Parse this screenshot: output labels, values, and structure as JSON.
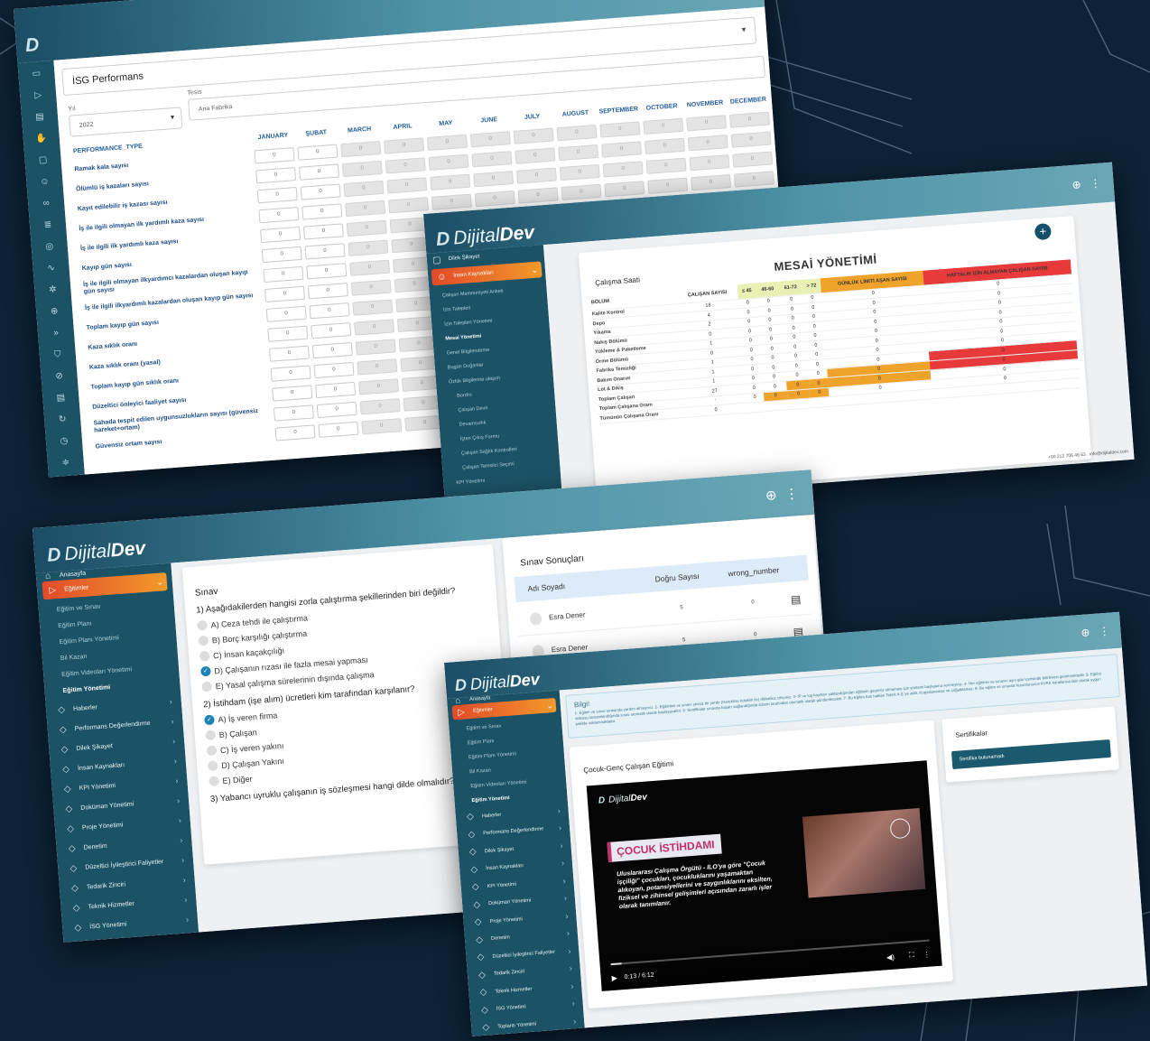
{
  "brand": {
    "name_light": "Dijital",
    "name_bold": "Dev",
    "mark": "D"
  },
  "colors": {
    "background": "#0d2236",
    "sidebar": "#1c5266",
    "accent": "#f0772a",
    "danger": "#e83a3a",
    "warning": "#f0a32a",
    "highlight": "#e8f0b4",
    "link_blue": "#1d4e86"
  },
  "topbar_icons": [
    "globe-icon",
    "more-vert-icon"
  ],
  "isg_window": {
    "page_title": "İSG Performans",
    "year_label": "Yıl",
    "year_value": "2022",
    "facility_label": "Tesis",
    "facility_value": "Ana Fabrika",
    "type_header": "PERFORMANCE_TYPE",
    "months": [
      "JANUARY",
      "ŞUBAT",
      "MARCH",
      "APRIL",
      "MAY",
      "JUNE",
      "JULY",
      "AUGUST",
      "SEPTEMBER",
      "OCTOBER",
      "NOVEMBER",
      "DECEMBER"
    ],
    "cell_value": "0",
    "rows": [
      "Ramak kala sayısı",
      "Ölümlü iş kazaları sayısı",
      "Kayıt edilebilir iş kazası sayısı",
      "İş ile ilgili olmayan ilk yardımlı kaza sayısı",
      "İş ile ilgili ilk yardımlı kaza sayısı",
      "Kayıp gün sayısı",
      "İş ile ilgili olmayan ilkyardımcı kazalardan oluşan kayıp gün sayısı",
      "İş ile ilgili ilkyardımlı kazalardan oluşan kayıp gün sayısı",
      "Toplam kayıp gün sayısı",
      "Kaza sıklık oranı",
      "Kaza sıklık oranı (yasal)",
      "Toplam kayıp gün sıklık oranı",
      "Düzeltici önleyici faaliyet sayısı",
      "Sahada tespit edilen uygunsuzlukların sayısı (güvensiz hareket+ortam)",
      "Güvensiz ortam sayısı"
    ],
    "side_icons": [
      "monitor-icon",
      "play-icon",
      "document-icon",
      "thumbs-up-icon",
      "chat-icon",
      "users-icon",
      "link-icon",
      "database-icon",
      "target-icon",
      "pulse-icon",
      "gear-icon",
      "globe-icon",
      "forward-icon",
      "shield-icon",
      "compass-icon",
      "doc-icon",
      "refresh-icon",
      "clock-icon",
      "sliders-icon"
    ]
  },
  "mesai_window": {
    "title": "MESAİ YÖNETİMİ",
    "subtitle": "Çalışma Saati",
    "add_button": "+",
    "menu_top": "Dilek Şikayet",
    "menu_active": "İnsan Kaynakları",
    "menu_sub": [
      "Çalışan Memnuniyeti Anketi",
      "İzin Talepleri",
      "İzin Talepleri Yönetimi",
      "Mesai Yönetimi",
      "Genel Bilgilendirme",
      "Bugün Doğanlar",
      "Özlük Bilgilerine ulaşım",
      "Bordro",
      "Çalışan Devri",
      "Devamsızlık",
      "İşten Çıkış Formu",
      "Çalışan Sağlık Kontrolleri",
      "Çalışan Temsilci Seçimi",
      "KPI Yönetimi"
    ],
    "columns": [
      "BÖLÜM",
      "ÇALIŞAN SAYISI",
      "≤ 45",
      "46-60",
      "61-72",
      "> 72",
      "GÜNLÜK LİMİTİ AŞAN SAYISI",
      "HAFTALIK İZİN ALMAYAN ÇALIŞAN SAYISI"
    ],
    "rows": [
      {
        "name": "Kalite Kontrol",
        "count": "18",
        "a": "0",
        "b": "0",
        "c": "0",
        "d": "0",
        "daily": "0",
        "weekly": "0"
      },
      {
        "name": "Depo",
        "count": "4",
        "a": "0",
        "b": "0",
        "c": "0",
        "d": "0",
        "daily": "0",
        "weekly": "0"
      },
      {
        "name": "Yıkama",
        "count": "2",
        "a": "0",
        "b": "0",
        "c": "0",
        "d": "0",
        "daily": "0",
        "weekly": "0"
      },
      {
        "name": "Nakış Bölümü",
        "count": "0",
        "a": "0",
        "b": "0",
        "c": "0",
        "d": "0",
        "daily": "0",
        "weekly": "0"
      },
      {
        "name": "Yükleme & Paketleme",
        "count": "1",
        "a": "0",
        "b": "0",
        "c": "0",
        "d": "0",
        "daily": "0",
        "weekly": "0"
      },
      {
        "name": "Örme Bölümü",
        "count": "0",
        "a": "0",
        "b": "0",
        "c": "0",
        "d": "0",
        "daily": "0",
        "weekly": "0"
      },
      {
        "name": "Fabrika Temizliği",
        "count": "1",
        "a": "0",
        "b": "0",
        "c": "0",
        "d": "0",
        "daily": "0",
        "weekly": "0"
      },
      {
        "name": "Bakım Onarım",
        "count": "1",
        "a": "0",
        "b": "0",
        "c": "0",
        "d": "0",
        "daily": "0",
        "weekly": "0"
      },
      {
        "name": "Lot & Dikiş",
        "count": "1",
        "a": "0",
        "b": "0",
        "c": "0",
        "d": "0",
        "daily": "0",
        "weekly": "0"
      },
      {
        "name": "Toplam Çalışan",
        "count": "27",
        "a": "0",
        "b": "0",
        "c": "0",
        "d": "0",
        "daily": "0",
        "weekly": "0"
      },
      {
        "name": "Toplam Çalışana Oranı",
        "count": "-",
        "a": "0",
        "b": "0",
        "c": "0",
        "d": "0",
        "daily": "0",
        "weekly": "0"
      },
      {
        "name": "Tümünün Çalışana Oranı",
        "count": "0",
        "a": "",
        "b": "",
        "c": "",
        "d": "",
        "daily": "",
        "weekly": ""
      }
    ],
    "footer": "+90 212 706 46 63 . info@dijitaldev.com"
  },
  "sinav_window": {
    "menu_top": "Anasayfa",
    "menu_active": "Eğitimler",
    "menu_sub": [
      "Eğitim ve Sınav",
      "Eğitim Planı",
      "Eğitim Planı Yönetimi",
      "Bil Kazan",
      "Eğitim Videoları Yönetimi",
      "Eğitim Yönetimi"
    ],
    "menu_main": [
      {
        "label": "Haberler",
        "icon": "news-icon"
      },
      {
        "label": "Performans Değerlendirme",
        "icon": "thumbs-up-icon"
      },
      {
        "label": "Dilek Şikayet",
        "icon": "chat-icon"
      },
      {
        "label": "İnsan Kaynakları",
        "icon": "users-icon"
      },
      {
        "label": "KPI Yönetimi",
        "icon": "link-icon"
      },
      {
        "label": "Doküman Yönetimi",
        "icon": "database-icon"
      },
      {
        "label": "Proje Yönetimi",
        "icon": "target-icon"
      },
      {
        "label": "Denetim",
        "icon": "pulse-icon"
      },
      {
        "label": "Düzeltici İyileştirici Faliyetler",
        "icon": "gear-icon"
      },
      {
        "label": "Tedarik Zinciri",
        "icon": "globe-icon"
      },
      {
        "label": "Teknik Hizmetler",
        "icon": "forward-icon"
      },
      {
        "label": "İSG Yönetimi",
        "icon": "shield-icon"
      },
      {
        "label": "Toplantı Yönetimi",
        "icon": "compass-icon"
      }
    ],
    "exam_title": "Sınav",
    "questions": [
      {
        "text": "1) Aşağıdakilerden hangisi zorla çalıştırma şekillerinden biri değildir?",
        "options": [
          {
            "text": "A) Ceza tehdi ile çalıştırma",
            "selected": false
          },
          {
            "text": "B) Borç karşılığı çalıştırma",
            "selected": false
          },
          {
            "text": "C) İnsan kaçakçılığı",
            "selected": false
          },
          {
            "text": "D) Çalışanın rızası ile fazla mesai yapması",
            "selected": true
          },
          {
            "text": "E) Yasal çalışma sürelerinin dışında çalışma",
            "selected": false
          }
        ]
      },
      {
        "text": "2) İstihdam (işe alım) ücretleri kim tarafından karşılanır?",
        "options": [
          {
            "text": "A) İş veren firma",
            "selected": true
          },
          {
            "text": "B) Çalışan",
            "selected": false
          },
          {
            "text": "C) İş veren yakını",
            "selected": false
          },
          {
            "text": "D) Çalışan Yakını",
            "selected": false
          },
          {
            "text": "E) Diğer",
            "selected": false
          }
        ]
      },
      {
        "text": "3) Yabancı uyruklu çalışanın iş sözleşmesi hangi dilde olmalıdır?",
        "options": []
      }
    ],
    "results_title": "Sınav Sonuçları",
    "results_headers": [
      "Adı Soyadı",
      "Doğru Sayısı",
      "wrong_number"
    ],
    "results": [
      {
        "name": "Esra Dener",
        "correct": "5",
        "wrong": "0"
      },
      {
        "name": "Esra Dener",
        "correct": "5",
        "wrong": "0"
      },
      {
        "name": "Esra Dener",
        "correct": "5",
        "wrong": "0"
      }
    ]
  },
  "egitim_window": {
    "menu_top": "Anasayfa",
    "menu_active": "Eğitimler",
    "menu_sub": [
      "Eğitim ve Sınav",
      "Eğitim Planı",
      "Eğitim Planı Yönetimi",
      "Bil Kazan",
      "Eğitim Videoları Yönetimi",
      "Eğitim Yönetimi"
    ],
    "info_title": "Bilgi!",
    "info_text": "1- Eğitim ve sınav sırasında yardım almayınız. 2- Eğitimleri ve sınavı sessiz bir yerde (Gerekirse kulaklık ile) dikkatlice izleyiniz. 3- IP ve log kayıtları saklandığından eğitimin geçersiz olmaması için yöntemi başkasına vermeyiniz. 4- Her eğitimin ve sınavın aynı gün içerisinde bitirilmesi gerekmektedir. 5- Eğitim videosu tamamlandığında sınav otomatik olarak başlayacaktır. 6- Sertifikalar sınavda başarı sağlandığında sistem tarafından otomatik olarak gönderilecektir. 7- Bu Eğitim tüm hakları Teknit A.Ş.'ye aittir. Kopyalanamaz ve çoğaltılamaz. 8- Bu eğitim ve sınavlar kurumunuzun KVKK kurallarına tabi olarak uygun şekilde saklanmaktadır.",
    "course_title": "Çocuk-Genç Çalışan Eğitimi",
    "video_banner": "ÇOCUK İSTİHDAMI",
    "video_text": "Uluslararası Çalışma Örgütü - ILO'ya göre \"Çocuk işçiliği\" çocukları, çocukluklarını yaşamaktan alıkoyan, potansiyellerini ve saygınlıklarını eksilten, fiziksel ve zihinsel gelişimleri açısından zararlı işler olarak tanımlanır.",
    "video_time": "0:13 / 6:12",
    "video_progress": 0.035,
    "cert_title": "Sertifikalar",
    "cert_empty": "Sertifika bulunamadı"
  }
}
